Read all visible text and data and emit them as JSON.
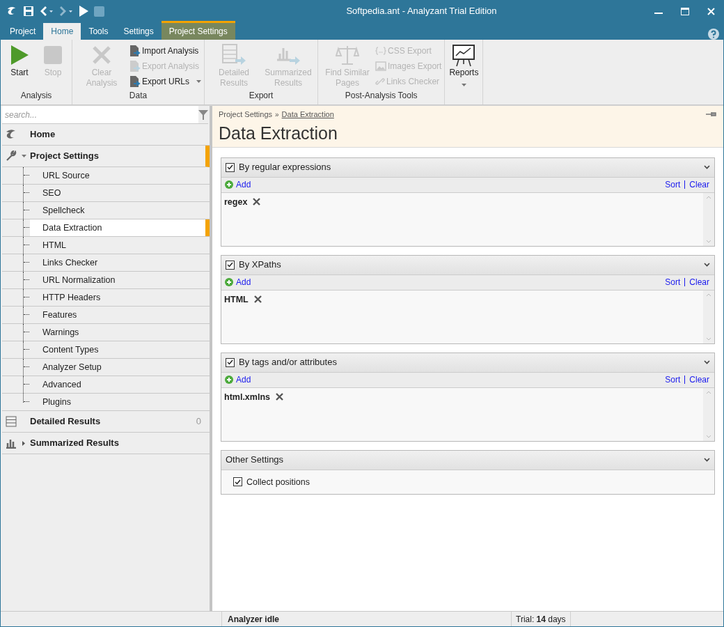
{
  "window": {
    "title": "Softpedia.ant - Analyzant Trial Edition"
  },
  "tabs": [
    {
      "label": "Project",
      "selected": false,
      "contextual": false
    },
    {
      "label": "Home",
      "selected": true,
      "contextual": false
    },
    {
      "label": "Tools",
      "selected": false,
      "contextual": false
    },
    {
      "label": "Settings",
      "selected": false,
      "contextual": false
    },
    {
      "label": "Project Settings",
      "selected": false,
      "contextual": true
    }
  ],
  "ribbon": [
    {
      "label": "Analysis",
      "items": [
        {
          "kind": "large",
          "label": "Start",
          "disabled": false
        },
        {
          "kind": "large",
          "label": "Stop",
          "disabled": true
        }
      ]
    },
    {
      "label": "Data",
      "items": [
        {
          "kind": "large",
          "label": "Clear Analysis",
          "disabled": true
        },
        {
          "kind": "small",
          "label": "Import Analysis",
          "disabled": false
        },
        {
          "kind": "small",
          "label": "Export Analysis",
          "disabled": true
        },
        {
          "kind": "small",
          "label": "Export URLs",
          "disabled": false,
          "dropdown": true
        }
      ]
    },
    {
      "label": "Export",
      "items": [
        {
          "kind": "large",
          "label": "Detailed Results",
          "disabled": true
        },
        {
          "kind": "large",
          "label": "Summarized Results",
          "disabled": true
        }
      ]
    },
    {
      "label": "Post-Analysis Tools",
      "items": [
        {
          "kind": "large",
          "label": "Find Similar Pages",
          "disabled": true
        },
        {
          "kind": "small",
          "label": "CSS Export",
          "disabled": true
        },
        {
          "kind": "small",
          "label": "Images Export",
          "disabled": true
        },
        {
          "kind": "small",
          "label": "Links Checker",
          "disabled": true
        }
      ]
    },
    {
      "items": [
        {
          "kind": "large",
          "label": "Reports",
          "disabled": false,
          "dropdown": true
        }
      ]
    }
  ],
  "sidebar": {
    "search": {
      "placeholder": "search..."
    },
    "items": [
      {
        "label": "Home",
        "selected": false
      },
      {
        "label": "Project Settings",
        "selected": true,
        "expanded": true,
        "children": [
          {
            "label": "URL Source",
            "selected": false
          },
          {
            "label": "SEO",
            "selected": false
          },
          {
            "label": "Spellcheck",
            "selected": false
          },
          {
            "label": "Data Extraction",
            "selected": true
          },
          {
            "label": "HTML",
            "selected": false
          },
          {
            "label": "Links Checker",
            "selected": false
          },
          {
            "label": "URL Normalization",
            "selected": false
          },
          {
            "label": "HTTP Headers",
            "selected": false
          },
          {
            "label": "Features",
            "selected": false
          },
          {
            "label": "Warnings",
            "selected": false
          },
          {
            "label": "Content Types",
            "selected": false
          },
          {
            "label": "Analyzer Setup",
            "selected": false
          },
          {
            "label": "Advanced",
            "selected": false
          },
          {
            "label": "Plugins",
            "selected": false
          }
        ]
      },
      {
        "label": "Detailed Results",
        "selected": false,
        "count": "0"
      },
      {
        "label": "Summarized Results",
        "selected": false,
        "expanded": false
      }
    ]
  },
  "main": {
    "breadcrumb": [
      "Project Settings",
      "Data Extraction"
    ],
    "breadcrumb_separator": "»",
    "title": "Data Extraction",
    "sections": [
      {
        "kind": "list",
        "title": "By regular expressions",
        "checked": true,
        "add": "Add",
        "sort": "Sort",
        "clear": "Clear",
        "entries": [
          "regex"
        ]
      },
      {
        "kind": "list",
        "title": "By XPaths",
        "checked": true,
        "add": "Add",
        "sort": "Sort",
        "clear": "Clear",
        "entries": [
          "HTML"
        ]
      },
      {
        "kind": "list",
        "title": "By tags and/or attributes",
        "checked": true,
        "add": "Add",
        "sort": "Sort",
        "clear": "Clear",
        "entries": [
          "html.xmlns"
        ]
      },
      {
        "kind": "options",
        "title": "Other Settings",
        "options": [
          {
            "label": "Collect positions",
            "checked": true
          }
        ]
      }
    ]
  },
  "status_bar": {
    "status": "Analyzer idle",
    "trial": "Trial: **14** days"
  }
}
